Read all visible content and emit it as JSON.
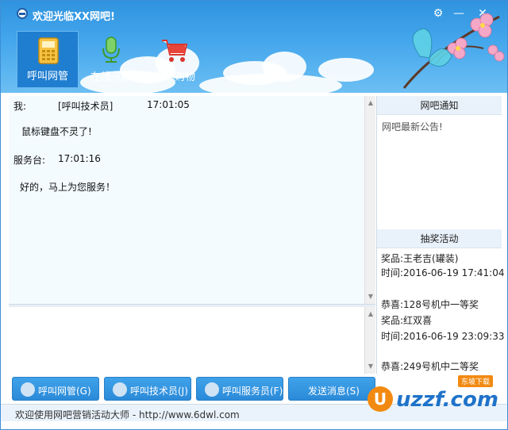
{
  "window": {
    "title": "欢迎光临XX网吧!"
  },
  "colors": {
    "accent": "#2f93df",
    "button": "#2b8ad8",
    "watermark": "#1f73c9",
    "watermark_badge": "#f28a12"
  },
  "nav": [
    {
      "label": "呼叫网管",
      "icon": "phone-icon",
      "active": true
    },
    {
      "label": "在线点歌",
      "icon": "microphone-icon",
      "active": false
    },
    {
      "label": "网吧购物",
      "icon": "shopping-cart-icon",
      "active": false
    }
  ],
  "chat": {
    "lines": [
      {
        "text": "我:"
      },
      {
        "text": "[呼叫技术员]"
      },
      {
        "text": "17:01:05"
      },
      {
        "text": "鼠标键盘不灵了!"
      },
      {
        "text": "服务台:"
      },
      {
        "text": "17:01:16"
      },
      {
        "text": "好的，马上为您服务！"
      }
    ]
  },
  "notice": {
    "header": "网吧通知",
    "text": "网吧最新公告!"
  },
  "lottery": {
    "header": "抽奖活动",
    "lines": [
      "奖品:王老吉(罐装)",
      "时间:2016-06-19 17:41:04",
      "恭喜:128号机中一等奖",
      "奖品:红双喜",
      "时间:2016-06-19 23:09:33",
      "恭喜:249号机中二等奖"
    ]
  },
  "buttons": {
    "call_admin": "呼叫网管(G)",
    "call_tech": "呼叫技术员(J)",
    "call_service": "呼叫服务员(F)",
    "send": "发送消息(S)"
  },
  "status": {
    "text": "欢迎使用网吧营销活动大师 - http://www.6dwl.com"
  },
  "watermark": {
    "text": "uzzf.com",
    "badge": "东坡下载"
  }
}
